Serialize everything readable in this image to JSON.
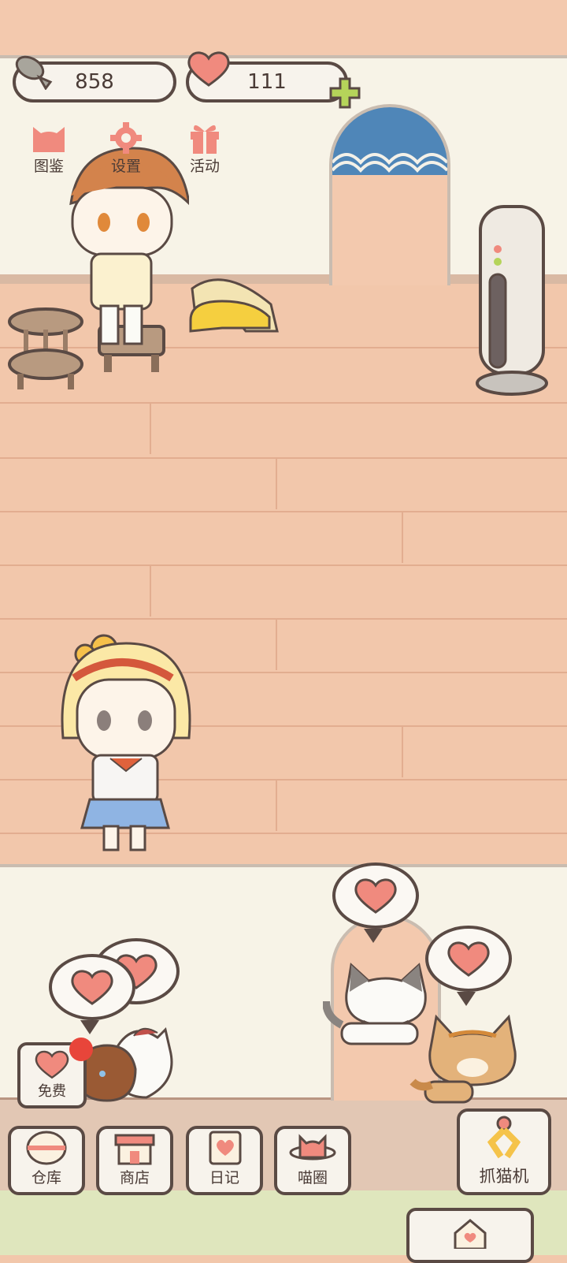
{
  "counters": {
    "fish": "858",
    "hearts": "111"
  },
  "top_menu": [
    {
      "label": "图鉴",
      "icon": "cat-head-icon"
    },
    {
      "label": "设置",
      "icon": "gear-icon"
    },
    {
      "label": "活动",
      "icon": "gift-icon"
    }
  ],
  "free_button": {
    "label": "免费"
  },
  "bottom_nav": [
    {
      "label": "仓库",
      "icon": "warehouse-icon"
    },
    {
      "label": "商店",
      "icon": "shop-icon"
    },
    {
      "label": "日记",
      "icon": "diary-icon"
    },
    {
      "label": "喵圈",
      "icon": "cat-planet-icon"
    }
  ],
  "claw_button": {
    "label": "抓猫机"
  },
  "colors": {
    "accent_heart": "#f08a7e",
    "outline": "#5a4a44",
    "plus": "#b5d45a",
    "floor": "#f2c7ab",
    "wall": "#f7f3e7"
  }
}
